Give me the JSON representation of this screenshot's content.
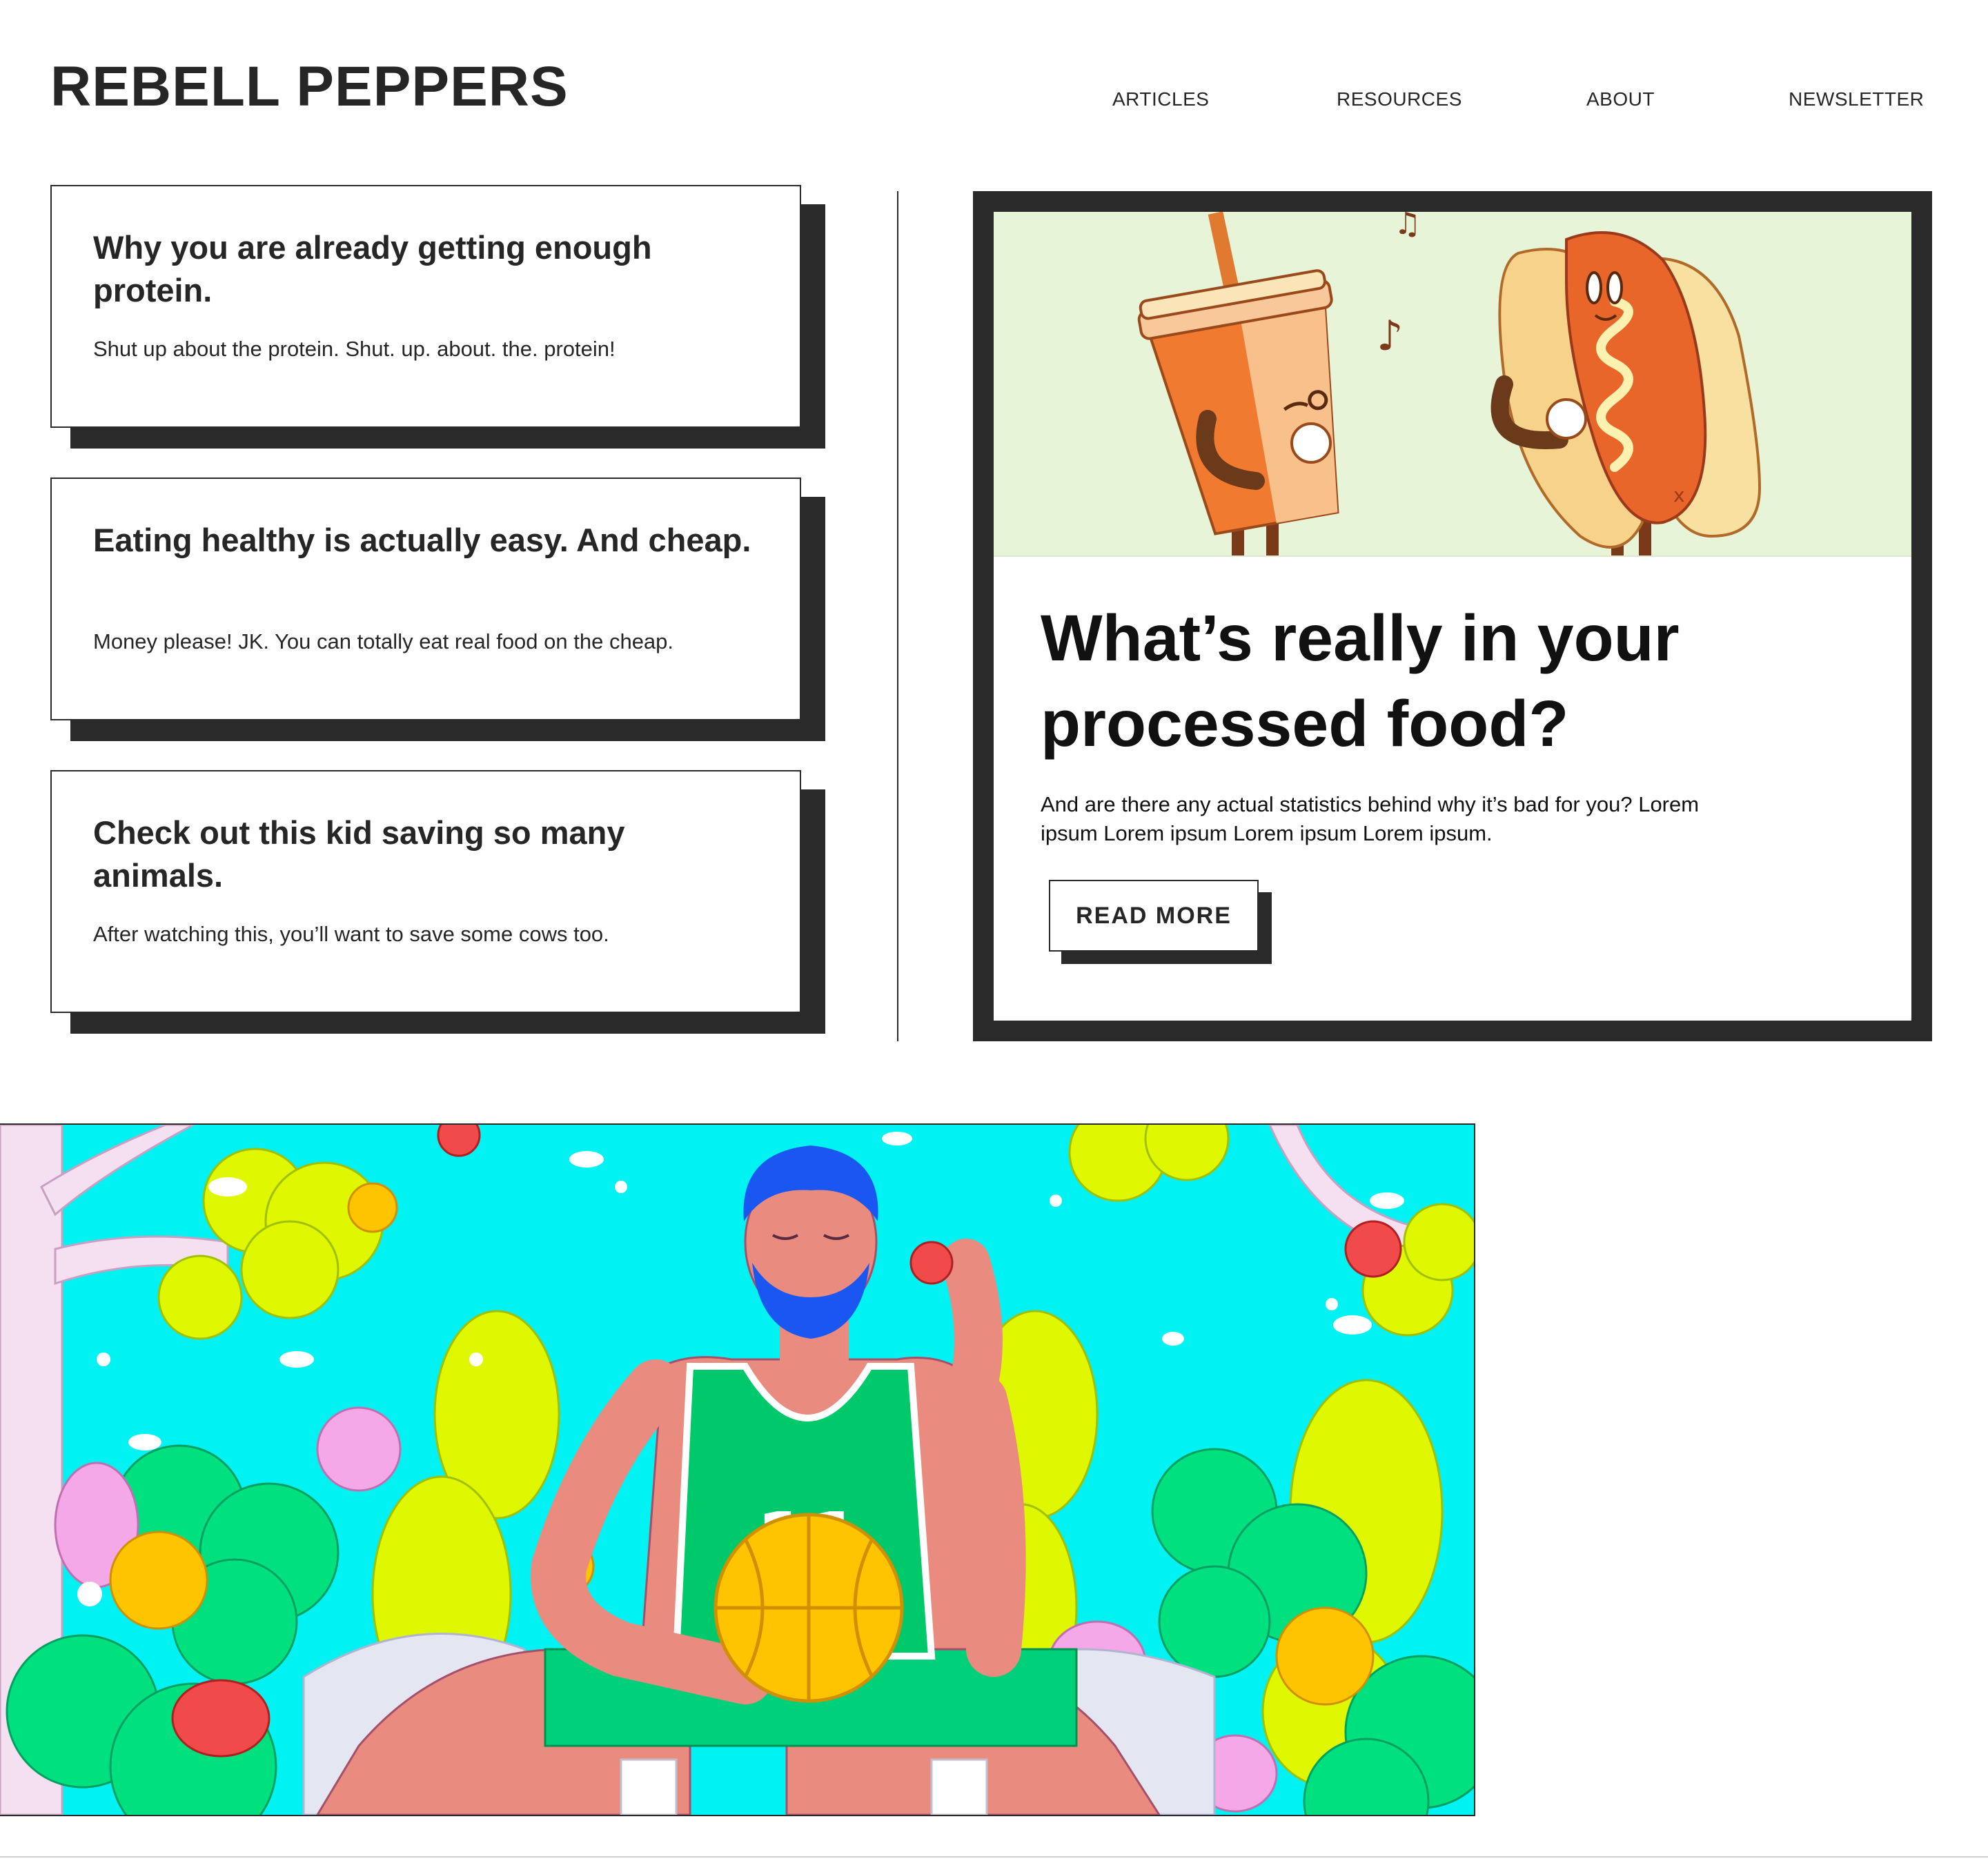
{
  "site": {
    "logo": "REBELL PEPPERS"
  },
  "nav": {
    "items": [
      "ARTICLES",
      "RESOURCES",
      "ABOUT",
      "NEWSLETTER"
    ]
  },
  "articles": [
    {
      "title": "Why you are already getting enough protein.",
      "description": "Shut up about the protein. Shut. up. about. the. protein!"
    },
    {
      "title": "Eating healthy is actually easy. And cheap.",
      "description": "Money please! JK. You can totally eat real food on the cheap."
    },
    {
      "title": "Check out this kid saving so many animals.",
      "description": "After watching this, you’ll want to save some cows too."
    }
  ],
  "featured": {
    "title": "What’s really in your processed food?",
    "description": "And are there any actual statistics behind why it’s bad for you? Lorem ipsum Lorem ipsum Lorem ipsum Lorem ipsum.",
    "button_label": "READ MORE",
    "illustration": "cartoon-cup-and-hotdog-illustration"
  },
  "hero": {
    "illustration": "basketball-player-among-fruits-illustration",
    "jersey_number": "11"
  },
  "colors": {
    "text": "#262626",
    "border": "#2a2a2a",
    "background": "#ffffff",
    "hero_sky": "#00f2f2",
    "hero_foliage": "#dff700",
    "hero_green": "#00d47c"
  }
}
